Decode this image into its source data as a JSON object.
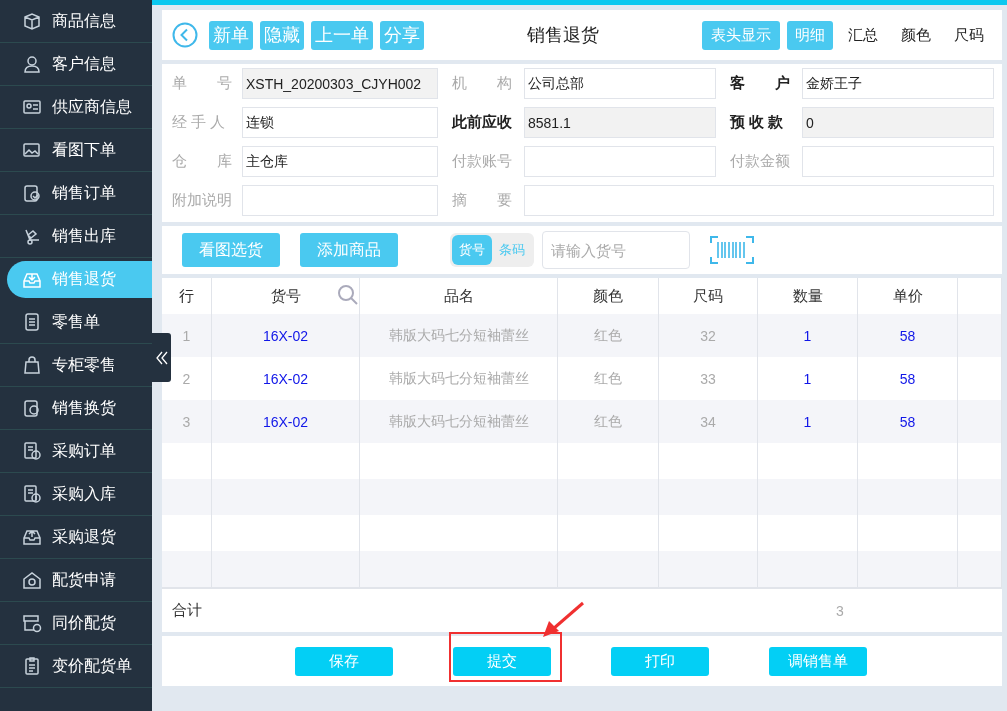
{
  "sidebar": {
    "items": [
      {
        "label": "商品信息",
        "selected": false
      },
      {
        "label": "客户信息",
        "selected": false
      },
      {
        "label": "供应商信息",
        "selected": false
      },
      {
        "label": "看图下单",
        "selected": false
      },
      {
        "label": "销售订单",
        "selected": false
      },
      {
        "label": "销售出库",
        "selected": false
      },
      {
        "label": "销售退货",
        "selected": true
      },
      {
        "label": "零售单",
        "selected": false
      },
      {
        "label": "专柜零售",
        "selected": false
      },
      {
        "label": "销售换货",
        "selected": false
      },
      {
        "label": "采购订单",
        "selected": false
      },
      {
        "label": "采购入库",
        "selected": false
      },
      {
        "label": "采购退货",
        "selected": false
      },
      {
        "label": "配货申请",
        "selected": false
      },
      {
        "label": "同价配货",
        "selected": false
      },
      {
        "label": "变价配货单",
        "selected": false
      }
    ]
  },
  "header": {
    "actions": [
      "新单",
      "隐藏",
      "上一单",
      "分享"
    ],
    "title": "销售退货",
    "header_toggle": "表头显示",
    "views": [
      {
        "label": "明细",
        "selected": true
      },
      {
        "label": "汇总",
        "selected": false
      },
      {
        "label": "颜色",
        "selected": false
      },
      {
        "label": "尺码",
        "selected": false
      }
    ]
  },
  "form": [
    [
      {
        "label": "单　　号",
        "value": "XSTH_20200303_CJYH002",
        "emphasis": false,
        "readonly": true
      },
      {
        "label": "机　　构",
        "value": "公司总部",
        "emphasis": false,
        "readonly": false
      },
      {
        "label": "客　　户",
        "value": "金娇王子",
        "emphasis": true,
        "readonly": false
      }
    ],
    [
      {
        "label": "经 手 人",
        "value": "连锁",
        "emphasis": false,
        "readonly": false
      },
      {
        "label": "此前应收",
        "value": "8581.1",
        "emphasis": true,
        "readonly": true
      },
      {
        "label": "预 收 款",
        "value": "0",
        "emphasis": true,
        "readonly": true
      }
    ],
    [
      {
        "label": "仓　　库",
        "value": "主仓库",
        "emphasis": false,
        "readonly": false
      },
      {
        "label": "付款账号",
        "emphasis": false,
        "readonly": false
      },
      {
        "label": "付款金额",
        "emphasis": false,
        "readonly": false
      }
    ],
    [
      {
        "label": "附加说明",
        "emphasis": false,
        "readonly": false
      },
      {
        "label": "摘　　要",
        "emphasis": false,
        "readonly": false
      }
    ]
  ],
  "toolbar": {
    "buttons": [
      "看图选货",
      "添加商品"
    ],
    "modes": [
      {
        "label": "货号",
        "selected": true
      },
      {
        "label": "条码",
        "selected": false
      }
    ],
    "search": {
      "placeholder": "请输入货号"
    }
  },
  "table": {
    "columns": [
      "行",
      "货号",
      "品名",
      "颜色",
      "尺码",
      "数量",
      "单价"
    ],
    "rows": [
      {
        "line": "1",
        "code": "16X-02",
        "name": "韩版大码七分短袖蕾丝",
        "shade": "红色",
        "size": "32",
        "qty": "1",
        "price": "58"
      },
      {
        "line": "2",
        "code": "16X-02",
        "name": "韩版大码七分短袖蕾丝",
        "shade": "红色",
        "size": "33",
        "qty": "1",
        "price": "58"
      },
      {
        "line": "3",
        "code": "16X-02",
        "name": "韩版大码七分短袖蕾丝",
        "shade": "红色",
        "size": "34",
        "qty": "1",
        "price": "58"
      }
    ],
    "total": {
      "label": "合计",
      "qty": "3"
    }
  },
  "footer": {
    "buttons": [
      {
        "label": "保存",
        "highlighted": false
      },
      {
        "label": "提交",
        "highlighted": true
      },
      {
        "label": "打印",
        "highlighted": false
      },
      {
        "label": "调销售单",
        "highlighted": false
      }
    ]
  }
}
